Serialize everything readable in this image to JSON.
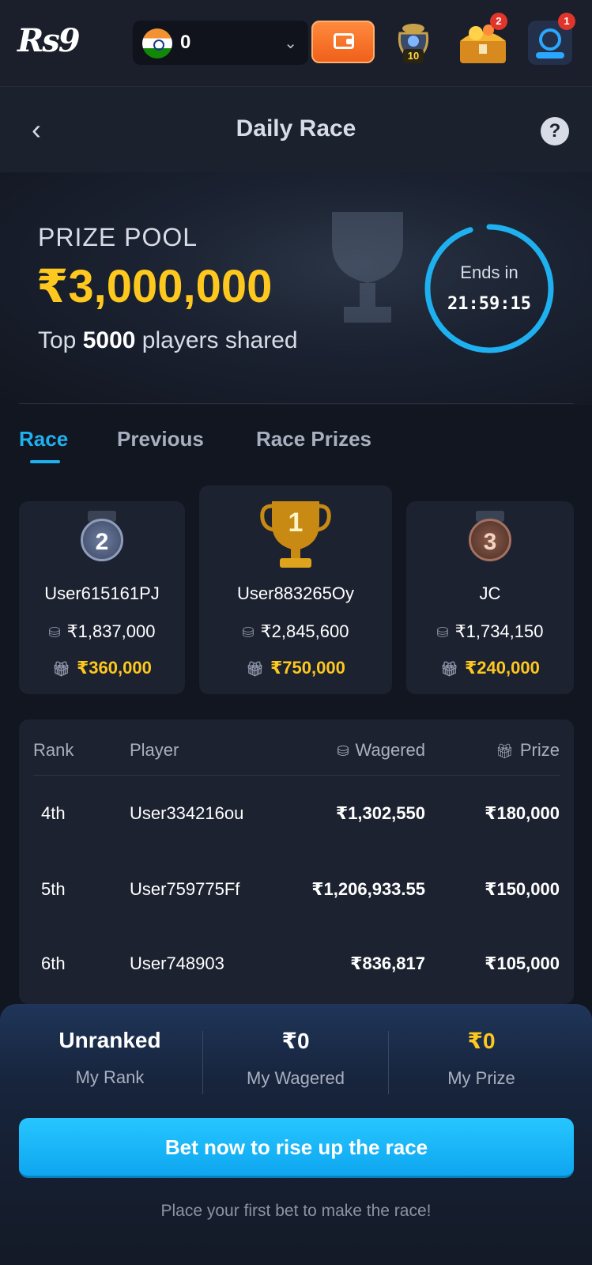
{
  "topbar": {
    "logo_text": "Rs9",
    "balance": "0",
    "pot_badge": "10",
    "chest_notifications": "2",
    "support_notifications": "1"
  },
  "header": {
    "title": "Daily Race"
  },
  "hero": {
    "prize_label": "PRIZE POOL",
    "prize_amount": "₹3,000,000",
    "sub_prefix": "Top ",
    "sub_count": "5000",
    "sub_suffix": " players shared",
    "timer_label": "Ends in",
    "timer_value": "21:59:15"
  },
  "tabs": [
    "Race",
    "Previous",
    "Race Prizes"
  ],
  "podium": [
    {
      "rank": "2",
      "name": "User615161PJ",
      "wagered": "₹1,837,000",
      "prize": "₹360,000"
    },
    {
      "rank": "1",
      "name": "User883265Oy",
      "wagered": "₹2,845,600",
      "prize": "₹750,000"
    },
    {
      "rank": "3",
      "name": "JC",
      "wagered": "₹1,734,150",
      "prize": "₹240,000"
    }
  ],
  "table": {
    "headers": {
      "rank": "Rank",
      "player": "Player",
      "wagered": "Wagered",
      "prize": "Prize"
    },
    "rows": [
      {
        "rank": "4th",
        "player": "User334216ou",
        "wagered": "₹1,302,550",
        "prize": "₹180,000"
      },
      {
        "rank": "5th",
        "player": "User759775Ff",
        "wagered": "₹1,206,933.55",
        "prize": "₹150,000"
      },
      {
        "rank": "6th",
        "player": "User748903",
        "wagered": "₹836,817",
        "prize": "₹105,000"
      }
    ]
  },
  "my_stats": {
    "rank_value": "Unranked",
    "rank_label": "My Rank",
    "wagered_value": "₹0",
    "wagered_label": "My Wagered",
    "prize_value": "₹0",
    "prize_label": "My Prize"
  },
  "cta": {
    "label": "Bet now to rise up the race",
    "hint": "Place your first bet to make the race!"
  },
  "colors": {
    "accent": "#1fb0f0",
    "gold": "#ffc81e",
    "background": "#121620"
  }
}
